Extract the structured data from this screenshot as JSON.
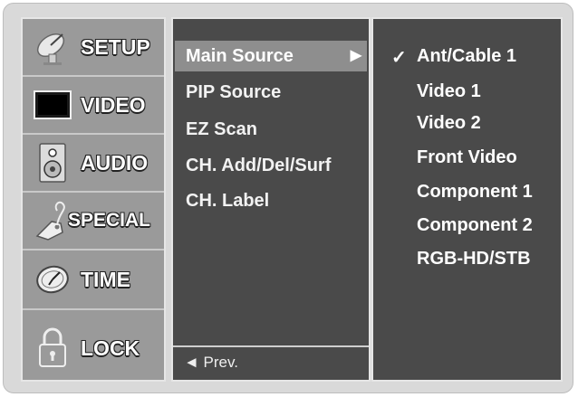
{
  "sidebar": {
    "tabs": [
      {
        "label": "SETUP",
        "icon": "satellite-dish-icon"
      },
      {
        "label": "VIDEO",
        "icon": "tv-screen-icon"
      },
      {
        "label": "AUDIO",
        "icon": "speaker-icon"
      },
      {
        "label": "SPECIAL",
        "icon": "tag-icon"
      },
      {
        "label": "TIME",
        "icon": "clock-icon"
      },
      {
        "label": "LOCK",
        "icon": "padlock-icon"
      }
    ],
    "selected": "SETUP"
  },
  "menu": {
    "items": [
      {
        "label": "Main Source"
      },
      {
        "label": "PIP Source"
      },
      {
        "label": "EZ Scan"
      },
      {
        "label": "CH. Add/Del/Surf"
      },
      {
        "label": "CH. Label"
      }
    ],
    "selected": "Main Source",
    "arrow": "▶",
    "prev_label": "◄ Prev."
  },
  "submenu": {
    "check": "✓",
    "options": [
      {
        "label": "Ant/Cable 1"
      },
      {
        "label": "Video 1"
      },
      {
        "label": "Video 2"
      },
      {
        "label": "Front Video"
      },
      {
        "label": "Component 1"
      },
      {
        "label": "Component 2"
      },
      {
        "label": "RGB-HD/STB"
      }
    ],
    "selected": "Ant/Cable 1"
  },
  "colors": {
    "frame": "#d9d9d9",
    "sidebar": "#9a9a9a",
    "menu_bg": "#4a4a4a",
    "highlight": "#8e8e8e"
  }
}
